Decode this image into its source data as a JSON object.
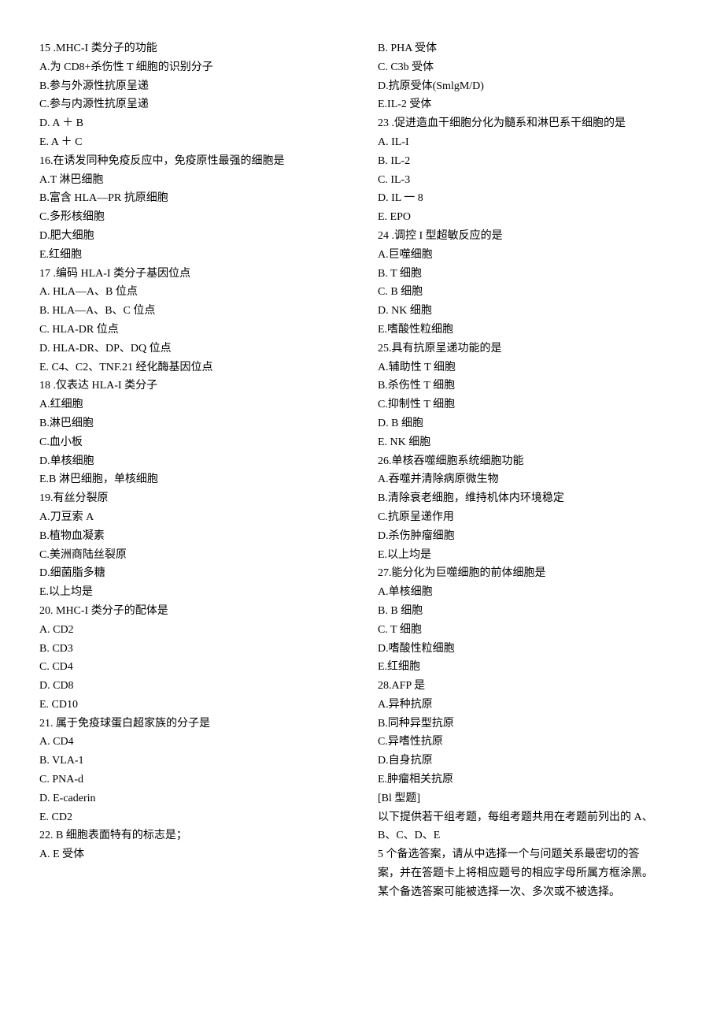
{
  "left": [
    "15 .MHC-I 类分子的功能",
    "A.为 CD8+杀伤性 T 细胞的识别分子",
    "B.参与外源性抗原呈递",
    "C.参与内源性抗原呈递",
    "D.  A ＋ B",
    "E.  A ＋ C",
    "16.在诱发同种免疫反应中，免疫原性最强的细胞是",
    "A.T 淋巴细胞",
    "B.富含 HLA—PR 抗原细胞",
    "C.多形核细胞",
    "D.肥大细胞",
    "E.红细胞",
    "17  .编码 HLA-I 类分子基因位点",
    "A.  HLA—A、B 位点",
    "B.  HLA—A、B、C 位点",
    "C.  HLA-DR 位点",
    "D.  HLA-DR、DP、DQ 位点",
    "E.  C4、C2、TNF.21 经化酶基因位点",
    "18  .仅表达 HLA-I 类分子",
    "A.红细胞",
    "B.淋巴细胞",
    "C.血小板",
    "D.单核细胞",
    "E.B 淋巴细胞，单核细胞",
    "19.有丝分裂原",
    "A.刀豆索 A",
    "B.植物血凝素",
    "C.美洲商陆丝裂原",
    "D.细菌脂多糖",
    "E.以上均是",
    "20.  MHC-I 类分子的配体是",
    "A.  CD2",
    "B.  CD3",
    "C.  CD4",
    "D.  CD8",
    "E.  CD10",
    "21.  属于免疫球蛋白超家族的分子是",
    "A.  CD4",
    "B.  VLA-1",
    "C.  PNA-d",
    "D.  E-caderin",
    "E.  CD2",
    "22.  B 细胞表面特有的标志是；",
    "A.  E 受体"
  ],
  "right": [
    "B.  PHA 受体",
    "C.  C3b 受体",
    "D.抗原受体(SmlgM/D)",
    "E.IL-2 受体",
    "23  .促进造血干细胞分化为髓系和淋巴系干细胞的是",
    "A.  IL-I",
    "B.  IL-2",
    "C.  IL-3",
    "D.  IL 一 8",
    "E.  EPO",
    "24  .调控 I 型超敏反应的是",
    "A.巨噬细胞",
    "B.  T 细胞",
    "C.  B 细胞",
    "D.  NK 细胞",
    "E.嗜酸性粒细胞",
    "25.具有抗原呈递功能的是",
    "A.辅助性 T 细胞",
    "B.杀伤性 T 细胞",
    "C.抑制性 T 细胞",
    "D.  B 细胞",
    "E.  NK 细胞",
    "26.单核吞噬细胞系统细胞功能",
    "A.吞噬并清除病原微生物",
    "B.清除衰老细胞，维持机体内环境稳定",
    "C.抗原呈递作用",
    "D.杀伤肿瘤细胞",
    "E.以上均是",
    "27.能分化为巨噬细胞的前体细胞是",
    "A.单核细胞",
    "B.  B 细胞",
    "C.  T 细胞",
    "D.嗜酸性粒细胞",
    "E.红细胞",
    "28.AFP 是",
    "A.异种抗原",
    "B.同种异型抗原",
    "C.异嗜性抗原",
    "D.自身抗原",
    "E.肿瘤相关抗原",
    "[Bl 型题]",
    "以下提供若干组考题，每组考题共用在考题前列出的 A、",
    "B、C、D、E",
    "5 个备选答案，请从中选择一个与问题关系最密切的答",
    "案，并在答题卡上将相应题号的相应字母所属方框涂黑。",
    "某个备选答案可能被选择一次、多次或不被选择。"
  ]
}
